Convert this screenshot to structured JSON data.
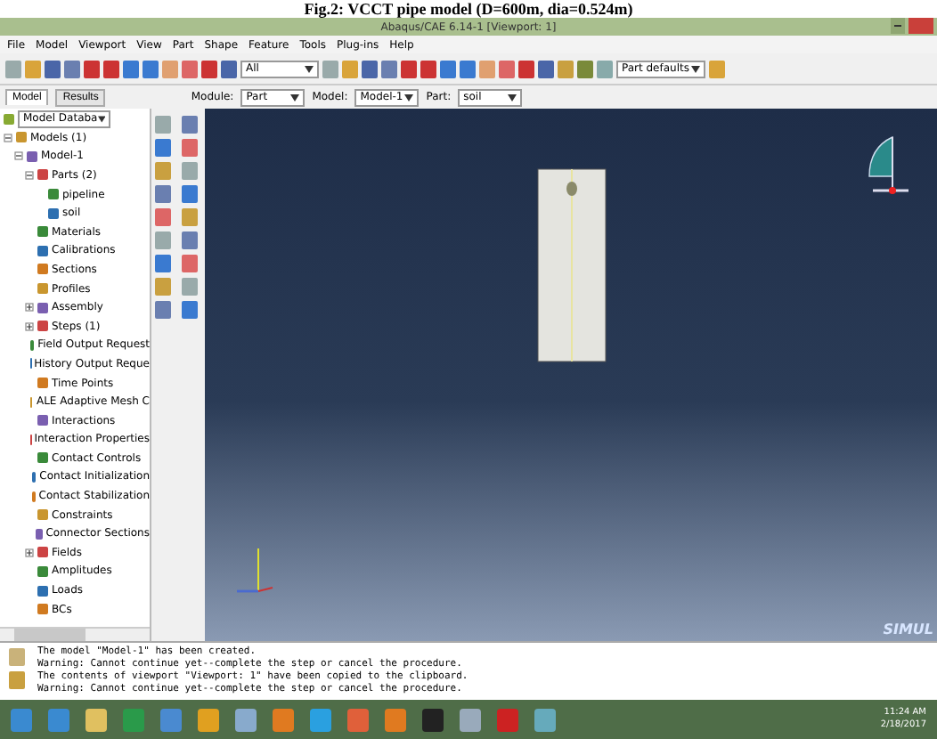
{
  "caption": "Fig.2: VCCT pipe model (D=600m, dia=0.524m)",
  "window": {
    "title": "Abaqus/CAE 6.14-1 [Viewport: 1]"
  },
  "menu": [
    "File",
    "Model",
    "Viewport",
    "View",
    "Part",
    "Shape",
    "Feature",
    "Tools",
    "Plug-ins",
    "Help"
  ],
  "toolbar": {
    "selection_filter": "All",
    "render_style": "Part defaults"
  },
  "tabs": [
    {
      "label": "Model",
      "selected": true
    },
    {
      "label": "Results",
      "selected": false
    }
  ],
  "context": [
    {
      "label": "Module:",
      "value": "Part"
    },
    {
      "label": "Model:",
      "value": "Model-1"
    },
    {
      "label": "Part:",
      "value": "soil"
    }
  ],
  "tree_source": "Model Databa",
  "tree": [
    {
      "label": "Models (1)",
      "expanded": true,
      "children": [
        {
          "label": "Model-1",
          "expanded": true,
          "children": [
            {
              "label": "Parts (2)",
              "expanded": true,
              "children": [
                {
                  "label": "pipeline"
                },
                {
                  "label": "soil"
                }
              ]
            },
            {
              "label": "Materials"
            },
            {
              "label": "Calibrations"
            },
            {
              "label": "Sections"
            },
            {
              "label": "Profiles"
            },
            {
              "label": "Assembly",
              "expanded": false
            },
            {
              "label": "Steps (1)",
              "expanded": false
            },
            {
              "label": "Field Output Request"
            },
            {
              "label": "History Output Reque"
            },
            {
              "label": "Time Points"
            },
            {
              "label": "ALE Adaptive Mesh C"
            },
            {
              "label": "Interactions"
            },
            {
              "label": "Interaction Properties"
            },
            {
              "label": "Contact Controls"
            },
            {
              "label": "Contact Initialization"
            },
            {
              "label": "Contact Stabilization"
            },
            {
              "label": "Constraints"
            },
            {
              "label": "Connector Sections"
            },
            {
              "label": "Fields",
              "expanded": false
            },
            {
              "label": "Amplitudes"
            },
            {
              "label": "Loads"
            },
            {
              "label": "BCs"
            }
          ]
        }
      ]
    }
  ],
  "viewport": {
    "brand": "SIMUL"
  },
  "messages": [
    "The model \"Model-1\" has been created.",
    "Warning: Cannot continue yet--complete the step or cancel the procedure.",
    "The contents of viewport \"Viewport: 1\" have been copied to the clipboard.",
    "Warning: Cannot continue yet--complete the step or cancel the procedure."
  ],
  "taskbar": {
    "time": "11:24 AM",
    "date": "2/18/2017"
  }
}
